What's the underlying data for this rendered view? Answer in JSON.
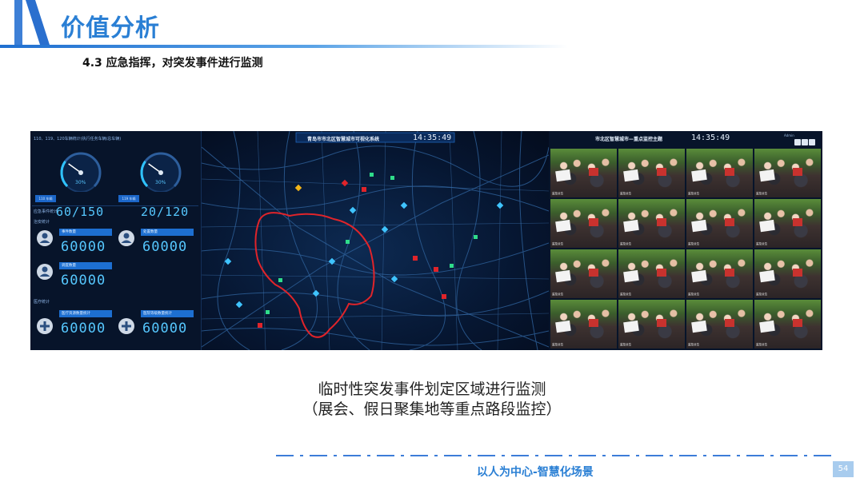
{
  "header": {
    "title": "价值分析",
    "subtitle": "4.3 应急指挥，对突发事件进行监测"
  },
  "left_panel": {
    "top_label": "110、119、120车辆统计(执行任务车辆/总车辆)",
    "gauge_1": {
      "percent_text": "30%",
      "tag": "110 车辆",
      "value": "60/150",
      "fill_fraction": 0.3
    },
    "gauge_2": {
      "percent_text": "30%",
      "tag": "119 车辆",
      "value": "20/120",
      "fill_fraction": 0.3
    },
    "section_label": "应急事件统计",
    "security_label": "治安统计",
    "medical_label": "医疗统计",
    "stats": {
      "event_count": {
        "label": "事件数量",
        "value": "60000"
      },
      "handled_count": {
        "label": "处置数量",
        "value": "60000"
      },
      "dispatch_count": {
        "label": "调度数量",
        "value": "60000"
      },
      "medical_count": {
        "label": "医疗资源数量统计",
        "value": "60000"
      },
      "hospital_count": {
        "label": "医院等级数量统计",
        "value": "60000"
      }
    }
  },
  "map_panel": {
    "title": "青岛市市北区智慧城市可视化系统",
    "clock": "14:35:49"
  },
  "camera_panel": {
    "title": "市北区智慧城市—重点监控主题",
    "clock": "14:35:49",
    "user": "Admin",
    "camera_label": "监控点位",
    "camera_count": 16
  },
  "caption": {
    "line1": "临时性突发事件划定区域进行监测",
    "line2": "（展会、假日聚集地等重点路段监控）"
  },
  "footer": {
    "slogan": "以人为中心-智慧化场景",
    "page": "54"
  },
  "colors": {
    "brand_blue": "#2a7fd4",
    "panel_bg": "#07142a",
    "digit_cyan": "#56c8ff",
    "zone_red": "#e0242a"
  }
}
